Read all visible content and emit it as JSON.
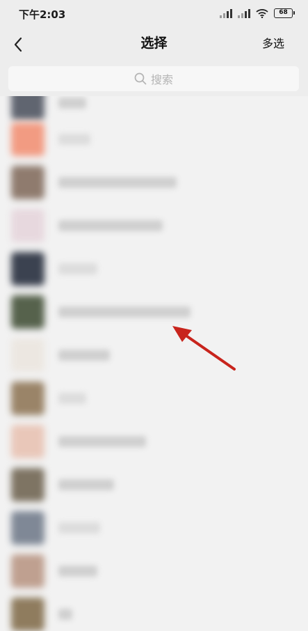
{
  "status_bar": {
    "time": "下午2:03",
    "battery": "68"
  },
  "nav": {
    "title": "选择",
    "action": "多选"
  },
  "search": {
    "placeholder": "搜索"
  },
  "contacts": [
    {
      "avatar_color": "#606570"
    },
    {
      "avatar_color": "#f29b82"
    },
    {
      "avatar_color": "#8f7b6e"
    },
    {
      "avatar_color": "#e7d8de"
    },
    {
      "avatar_color": "#3b4250"
    },
    {
      "avatar_color": "#56624c"
    },
    {
      "avatar_color": "#ece7e1"
    },
    {
      "avatar_color": "#9a8468"
    },
    {
      "avatar_color": "#e9c7b9"
    },
    {
      "avatar_color": "#7e7463"
    },
    {
      "avatar_color": "#7f8896"
    },
    {
      "avatar_color": "#bfa090"
    },
    {
      "avatar_color": "#8f7c5e"
    }
  ],
  "colors": {
    "background": "#ededed",
    "arrow": "#c8241c"
  }
}
